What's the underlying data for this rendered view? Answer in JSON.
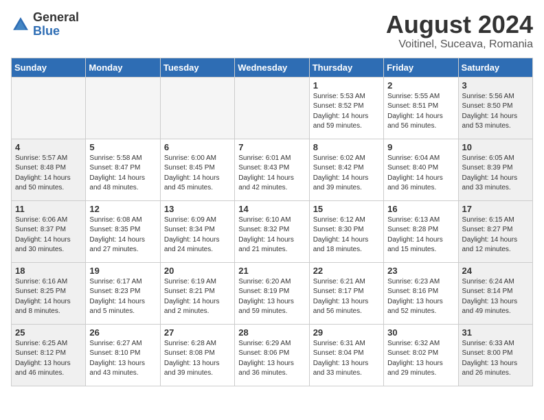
{
  "header": {
    "logo_general": "General",
    "logo_blue": "Blue",
    "month_year": "August 2024",
    "location": "Voitinel, Suceava, Romania"
  },
  "days_of_week": [
    "Sunday",
    "Monday",
    "Tuesday",
    "Wednesday",
    "Thursday",
    "Friday",
    "Saturday"
  ],
  "weeks": [
    [
      {
        "day": "",
        "info": "",
        "empty": true
      },
      {
        "day": "",
        "info": "",
        "empty": true
      },
      {
        "day": "",
        "info": "",
        "empty": true
      },
      {
        "day": "",
        "info": "",
        "empty": true
      },
      {
        "day": "1",
        "info": "Sunrise: 5:53 AM\nSunset: 8:52 PM\nDaylight: 14 hours\nand 59 minutes."
      },
      {
        "day": "2",
        "info": "Sunrise: 5:55 AM\nSunset: 8:51 PM\nDaylight: 14 hours\nand 56 minutes."
      },
      {
        "day": "3",
        "info": "Sunrise: 5:56 AM\nSunset: 8:50 PM\nDaylight: 14 hours\nand 53 minutes."
      }
    ],
    [
      {
        "day": "4",
        "info": "Sunrise: 5:57 AM\nSunset: 8:48 PM\nDaylight: 14 hours\nand 50 minutes."
      },
      {
        "day": "5",
        "info": "Sunrise: 5:58 AM\nSunset: 8:47 PM\nDaylight: 14 hours\nand 48 minutes."
      },
      {
        "day": "6",
        "info": "Sunrise: 6:00 AM\nSunset: 8:45 PM\nDaylight: 14 hours\nand 45 minutes."
      },
      {
        "day": "7",
        "info": "Sunrise: 6:01 AM\nSunset: 8:43 PM\nDaylight: 14 hours\nand 42 minutes."
      },
      {
        "day": "8",
        "info": "Sunrise: 6:02 AM\nSunset: 8:42 PM\nDaylight: 14 hours\nand 39 minutes."
      },
      {
        "day": "9",
        "info": "Sunrise: 6:04 AM\nSunset: 8:40 PM\nDaylight: 14 hours\nand 36 minutes."
      },
      {
        "day": "10",
        "info": "Sunrise: 6:05 AM\nSunset: 8:39 PM\nDaylight: 14 hours\nand 33 minutes."
      }
    ],
    [
      {
        "day": "11",
        "info": "Sunrise: 6:06 AM\nSunset: 8:37 PM\nDaylight: 14 hours\nand 30 minutes."
      },
      {
        "day": "12",
        "info": "Sunrise: 6:08 AM\nSunset: 8:35 PM\nDaylight: 14 hours\nand 27 minutes."
      },
      {
        "day": "13",
        "info": "Sunrise: 6:09 AM\nSunset: 8:34 PM\nDaylight: 14 hours\nand 24 minutes."
      },
      {
        "day": "14",
        "info": "Sunrise: 6:10 AM\nSunset: 8:32 PM\nDaylight: 14 hours\nand 21 minutes."
      },
      {
        "day": "15",
        "info": "Sunrise: 6:12 AM\nSunset: 8:30 PM\nDaylight: 14 hours\nand 18 minutes."
      },
      {
        "day": "16",
        "info": "Sunrise: 6:13 AM\nSunset: 8:28 PM\nDaylight: 14 hours\nand 15 minutes."
      },
      {
        "day": "17",
        "info": "Sunrise: 6:15 AM\nSunset: 8:27 PM\nDaylight: 14 hours\nand 12 minutes."
      }
    ],
    [
      {
        "day": "18",
        "info": "Sunrise: 6:16 AM\nSunset: 8:25 PM\nDaylight: 14 hours\nand 8 minutes."
      },
      {
        "day": "19",
        "info": "Sunrise: 6:17 AM\nSunset: 8:23 PM\nDaylight: 14 hours\nand 5 minutes."
      },
      {
        "day": "20",
        "info": "Sunrise: 6:19 AM\nSunset: 8:21 PM\nDaylight: 14 hours\nand 2 minutes."
      },
      {
        "day": "21",
        "info": "Sunrise: 6:20 AM\nSunset: 8:19 PM\nDaylight: 13 hours\nand 59 minutes."
      },
      {
        "day": "22",
        "info": "Sunrise: 6:21 AM\nSunset: 8:17 PM\nDaylight: 13 hours\nand 56 minutes."
      },
      {
        "day": "23",
        "info": "Sunrise: 6:23 AM\nSunset: 8:16 PM\nDaylight: 13 hours\nand 52 minutes."
      },
      {
        "day": "24",
        "info": "Sunrise: 6:24 AM\nSunset: 8:14 PM\nDaylight: 13 hours\nand 49 minutes."
      }
    ],
    [
      {
        "day": "25",
        "info": "Sunrise: 6:25 AM\nSunset: 8:12 PM\nDaylight: 13 hours\nand 46 minutes."
      },
      {
        "day": "26",
        "info": "Sunrise: 6:27 AM\nSunset: 8:10 PM\nDaylight: 13 hours\nand 43 minutes."
      },
      {
        "day": "27",
        "info": "Sunrise: 6:28 AM\nSunset: 8:08 PM\nDaylight: 13 hours\nand 39 minutes."
      },
      {
        "day": "28",
        "info": "Sunrise: 6:29 AM\nSunset: 8:06 PM\nDaylight: 13 hours\nand 36 minutes."
      },
      {
        "day": "29",
        "info": "Sunrise: 6:31 AM\nSunset: 8:04 PM\nDaylight: 13 hours\nand 33 minutes."
      },
      {
        "day": "30",
        "info": "Sunrise: 6:32 AM\nSunset: 8:02 PM\nDaylight: 13 hours\nand 29 minutes."
      },
      {
        "day": "31",
        "info": "Sunrise: 6:33 AM\nSunset: 8:00 PM\nDaylight: 13 hours\nand 26 minutes."
      }
    ]
  ]
}
